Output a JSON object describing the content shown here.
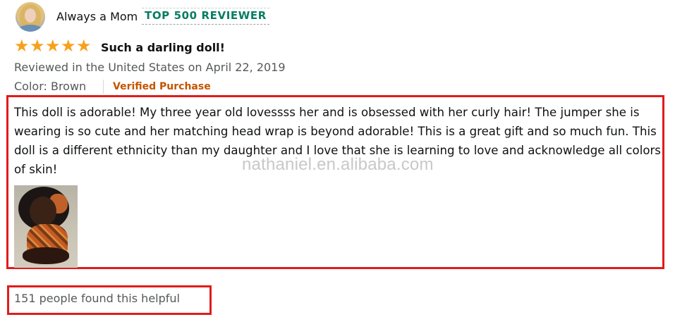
{
  "review": {
    "author": "Always a Mom",
    "badge": "TOP 500 REVIEWER",
    "rating": 5,
    "rating_max": 5,
    "headline": "Such a darling doll!",
    "meta": "Reviewed in the United States on April 22, 2019",
    "color": "Color: Brown",
    "verified": "Verified Purchase",
    "body": "This doll is adorable! My three year old lovessss her and is obsessed with her curly hair! The jumper she is wearing is so cute and her matching head wrap is beyond adorable! This is a great gift and so much fun. This doll is a different ethnicity than my daughter and I love that she is learning to love and acknowledge all colors of skin!",
    "helpful": "151 people found this helpful"
  },
  "watermark": "nathaniel.en.alibaba.com",
  "icons": {
    "star": "star-icon",
    "avatar": "user-avatar"
  },
  "colors": {
    "star": "#f7a01d",
    "badge": "#067d62",
    "verified": "#c45500",
    "highlight": "#e21b1b"
  }
}
